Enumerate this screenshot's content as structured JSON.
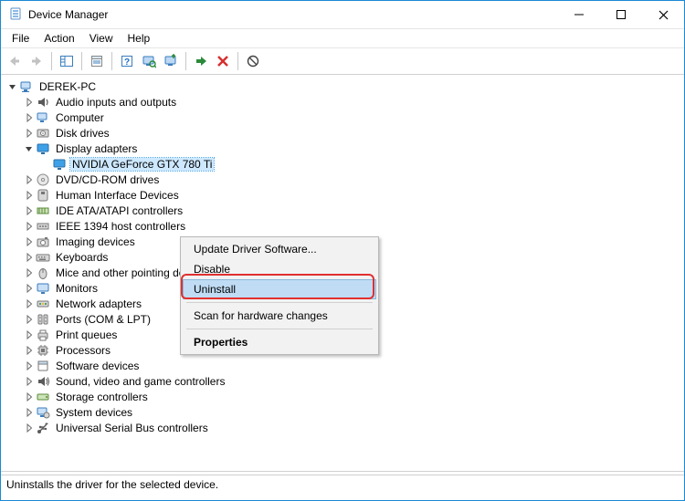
{
  "window": {
    "title": "Device Manager"
  },
  "menubar": {
    "file": "File",
    "action": "Action",
    "view": "View",
    "help": "Help"
  },
  "tree": {
    "root": "DEREK-PC",
    "categories": [
      "Audio inputs and outputs",
      "Computer",
      "Disk drives",
      "Display adapters",
      "DVD/CD-ROM drives",
      "Human Interface Devices",
      "IDE ATA/ATAPI controllers",
      "IEEE 1394 host controllers",
      "Imaging devices",
      "Keyboards",
      "Mice and other pointing devices",
      "Monitors",
      "Network adapters",
      "Ports (COM & LPT)",
      "Print queues",
      "Processors",
      "Software devices",
      "Sound, video and game controllers",
      "Storage controllers",
      "System devices",
      "Universal Serial Bus controllers"
    ],
    "display_adapter_child": "NVIDIA GeForce GTX 780 Ti"
  },
  "context_menu": {
    "update": "Update Driver Software...",
    "disable": "Disable",
    "uninstall": "Uninstall",
    "scan": "Scan for hardware changes",
    "properties": "Properties"
  },
  "statusbar": {
    "text": "Uninstalls the driver for the selected device."
  }
}
